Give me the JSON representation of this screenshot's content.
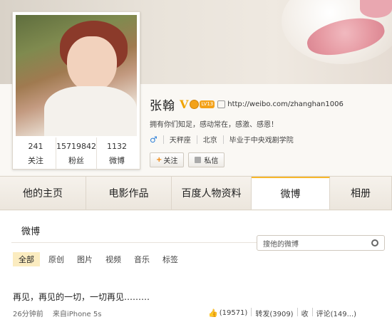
{
  "profile": {
    "name": "张翰",
    "verified": "V",
    "level": "LV13",
    "url": "http://weibo.com/zhanghan1006",
    "motto": "拥有你们知足，感动常在，感激、感恩！",
    "gender_icon": "♂",
    "zodiac": "天秤座",
    "city": "北京",
    "school": "毕业于中央戏剧学院",
    "follow_label": "关注",
    "message_label": "私信"
  },
  "stats": {
    "following": {
      "num": "241",
      "label": "关注"
    },
    "fans": {
      "num": "15719842",
      "label": "粉丝"
    },
    "weibo": {
      "num": "1132",
      "label": "微博"
    }
  },
  "tabs": [
    {
      "label": "他的主页"
    },
    {
      "label": "电影作品"
    },
    {
      "label": "百度人物资料"
    },
    {
      "label": "微博"
    },
    {
      "label": "相册"
    }
  ],
  "feed": {
    "title": "微博",
    "search_placeholder": "搜他的微博",
    "filters": [
      "全部",
      "原创",
      "图片",
      "视频",
      "音乐",
      "标签"
    ]
  },
  "post": {
    "text": "再见，再见的一切，一切再见………",
    "time": "26分钟前",
    "source": "来自iPhone 5s",
    "likes": "(19571)",
    "repost": "转发(3909)",
    "collect": "收",
    "comment": "评论(149...)"
  },
  "colors": {
    "tab_active_border": "#f7b72b",
    "filter_active_bg": "#fbecc0",
    "verified": "#f0a400"
  }
}
